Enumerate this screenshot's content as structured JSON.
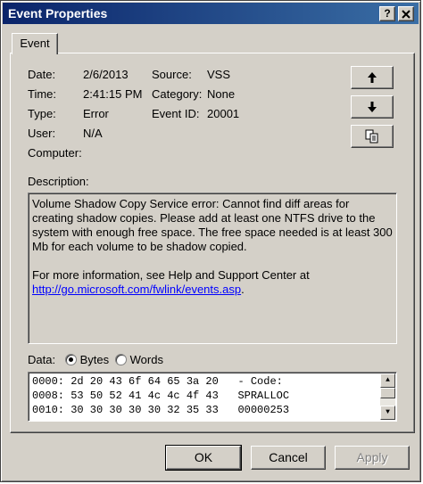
{
  "window": {
    "title": "Event Properties",
    "help_button": "?",
    "close_button": "X"
  },
  "tabs": [
    {
      "label": "Event"
    }
  ],
  "fields": {
    "date_label": "Date:",
    "date_value": "2/6/2013",
    "source_label": "Source:",
    "source_value": "VSS",
    "time_label": "Time:",
    "time_value": "2:41:15 PM",
    "category_label": "Category:",
    "category_value": "None",
    "type_label": "Type:",
    "type_value": "Error",
    "event_id_label": "Event ID:",
    "event_id_value": "20001",
    "user_label": "User:",
    "user_value": "N/A",
    "computer_label": "Computer:",
    "computer_value": ""
  },
  "description": {
    "label": "Description:",
    "text": "Volume Shadow Copy Service error: Cannot find diff areas for creating shadow copies. Please add at least one NTFS drive to the system with enough free space. The free space needed is at least 300 Mb for each volume to be shadow copied.",
    "more_info": "For more information, see Help and Support Center at",
    "link": "http://go.microsoft.com/fwlink/events.asp",
    "link_suffix": "."
  },
  "data": {
    "label": "Data:",
    "option_bytes": "Bytes",
    "option_words": "Words",
    "selected": "Bytes",
    "rows": [
      "0000: 2d 20 43 6f 64 65 3a 20   - Code:",
      "0008: 53 50 52 41 4c 4c 4f 43   SPRALLOC",
      "0010: 30 30 30 30 30 32 35 33   00000253"
    ]
  },
  "buttons": {
    "ok": "OK",
    "cancel": "Cancel",
    "apply": "Apply"
  },
  "icons": {
    "previous": "up-arrow-icon",
    "next": "down-arrow-icon",
    "copy": "copy-icon"
  },
  "colors": {
    "title_start": "#0a246a",
    "title_end": "#3a6ea5",
    "face": "#d4d0c8",
    "link": "#0000ff"
  }
}
